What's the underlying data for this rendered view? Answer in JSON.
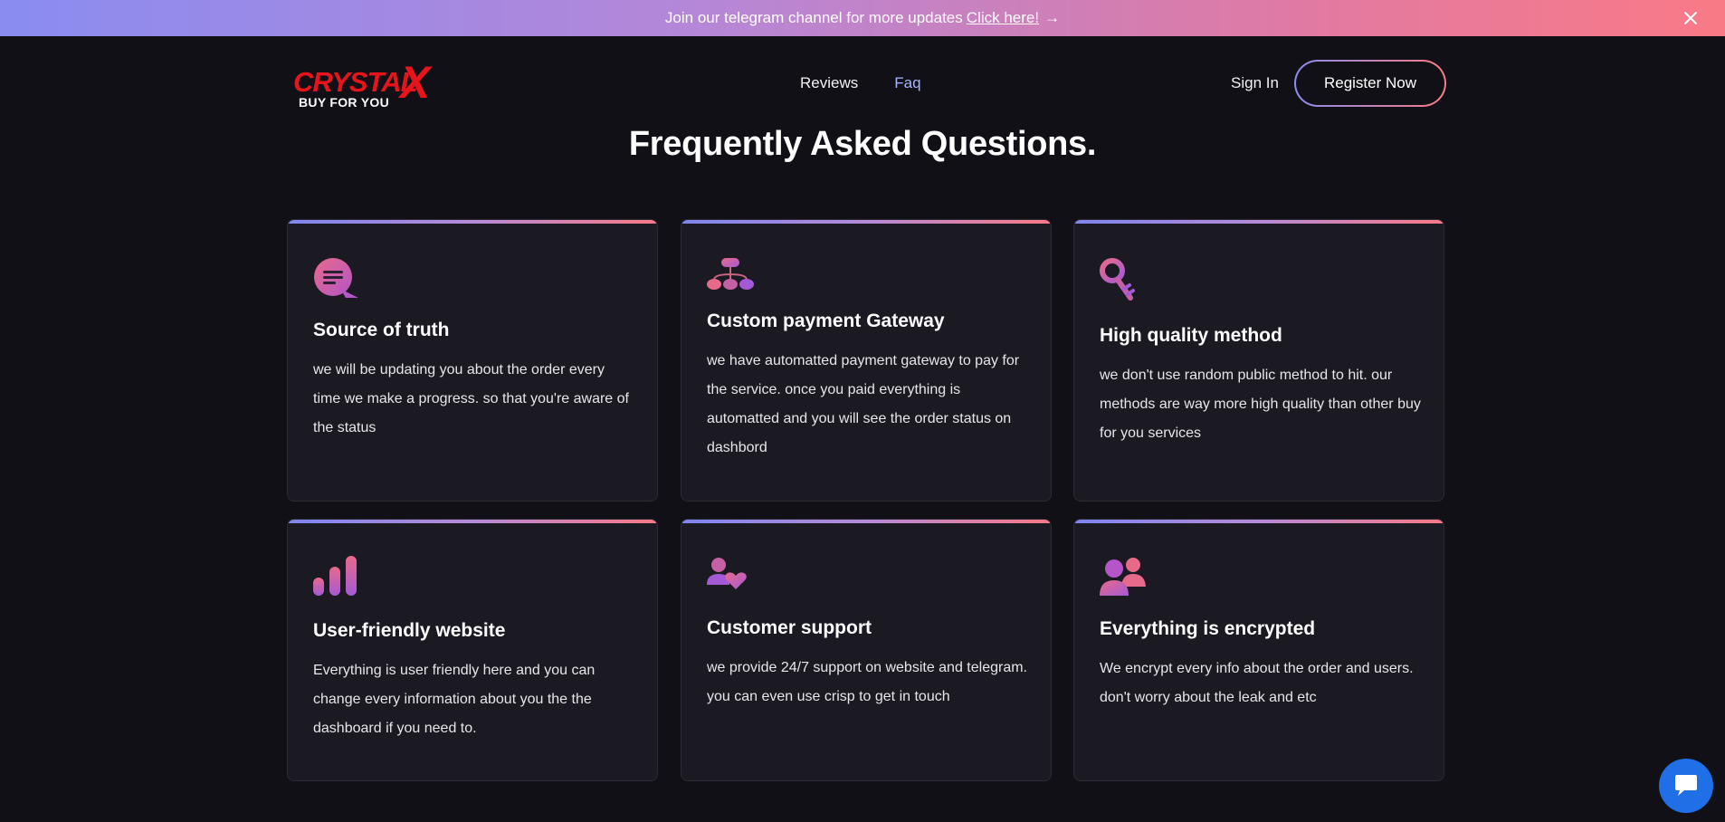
{
  "banner": {
    "text": "Join our telegram channel for more updates",
    "link_label": "Click here!",
    "arrow": "→",
    "close_icon": "close-icon"
  },
  "header": {
    "logo_word": "CRYSTAL",
    "logo_x": "X",
    "logo_tagline": "BUY FOR YOU",
    "nav": {
      "reviews": "Reviews",
      "faq": "Faq"
    },
    "sign_in": "Sign In",
    "register": "Register Now"
  },
  "page": {
    "title": "Frequently Asked Questions."
  },
  "cards": [
    {
      "icon": "chat-bubble-icon",
      "title": "Source of truth",
      "text": "we will be updating you about the order every time we make a progress. so that you're aware of the status"
    },
    {
      "icon": "hierarchy-icon",
      "title": "Custom payment Gateway",
      "text": "we have automatted payment gateway to pay for the service. once you paid everything is automatted and you will see the order status on dashbord"
    },
    {
      "icon": "key-icon",
      "title": "High quality method",
      "text": "we don't use random public method to hit. our methods are way more high quality than other buy for you services"
    },
    {
      "icon": "bar-chart-icon",
      "title": "User-friendly website",
      "text": "Everything is user friendly here and you can change every information about you the the dashboard if you need to."
    },
    {
      "icon": "user-heart-icon",
      "title": "Customer support",
      "text": "we provide 24/7 support on website and telegram. you can even use crisp to get in touch"
    },
    {
      "icon": "users-icon",
      "title": "Everything is encrypted",
      "text": "We encrypt every info about the order and users. don't worry about the leak and etc"
    }
  ],
  "colors": {
    "background": "#111016",
    "card": "#1b1922",
    "accent_start": "#8a8cf0",
    "accent_end": "#f97a86",
    "brand_red": "#e8141c",
    "chat_blue": "#1f6fe6"
  },
  "chat_widget": {
    "icon": "chat-icon"
  }
}
